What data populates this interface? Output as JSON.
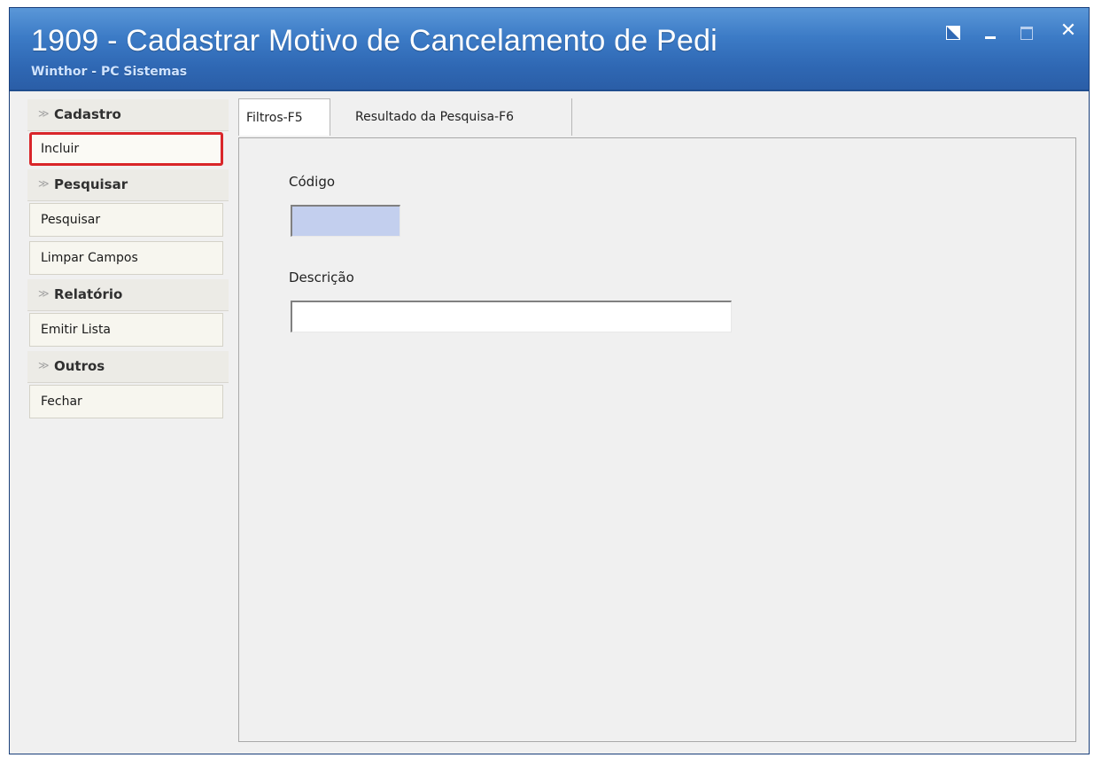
{
  "window": {
    "title": "1909 - Cadastrar Motivo de Cancelamento de Pedi",
    "subtitle": "Winthor - PC Sistemas",
    "controls": {
      "close": "✕"
    }
  },
  "sidebar": {
    "sections": [
      {
        "label": "Cadastro",
        "items": [
          {
            "label": "Incluir",
            "highlighted": true
          }
        ]
      },
      {
        "label": "Pesquisar",
        "items": [
          {
            "label": "Pesquisar"
          },
          {
            "label": "Limpar Campos"
          }
        ]
      },
      {
        "label": "Relatório",
        "items": [
          {
            "label": "Emitir Lista"
          }
        ]
      },
      {
        "label": "Outros",
        "items": [
          {
            "label": "Fechar"
          }
        ]
      }
    ]
  },
  "tabs": [
    {
      "label": "Filtros-F5",
      "active": true
    },
    {
      "label": "Resultado da Pesquisa-F6",
      "active": false
    }
  ],
  "filters": {
    "codigo": {
      "label": "Código",
      "value": ""
    },
    "descricao": {
      "label": "Descrição",
      "value": ""
    }
  },
  "colors": {
    "titlebar": "#2f68b4",
    "highlight_border": "#d9262a",
    "codigo_field_bg": "#c3cfee"
  }
}
